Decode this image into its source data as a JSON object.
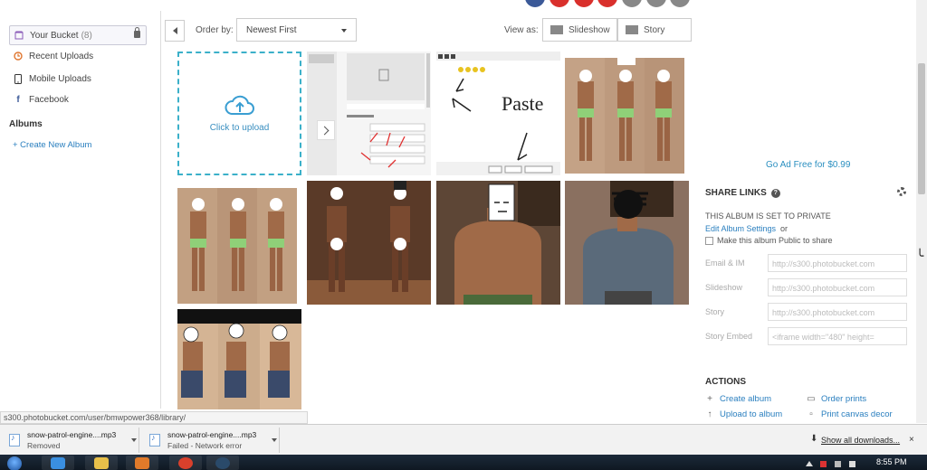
{
  "sidebar": {
    "items": [
      {
        "label": "Your Bucket",
        "count": "(8)",
        "icon": "bucket-icon"
      },
      {
        "label": "Recent Uploads",
        "icon": "clock-icon"
      },
      {
        "label": "Mobile Uploads",
        "icon": "mobile-icon"
      },
      {
        "label": "Facebook",
        "icon": "facebook-icon"
      }
    ],
    "albums_heading": "Albums",
    "create_album": "+ Create New Album"
  },
  "toolbar": {
    "order_by_label": "Order by:",
    "order_by_value": "Newest First",
    "view_as_label": "View as:",
    "slideshow_label": "Slideshow",
    "story_label": "Story"
  },
  "grid": {
    "upload_label": "Click to upload"
  },
  "panel": {
    "ad_free": "Go Ad Free for $0.99",
    "share_heading": "SHARE LINKS",
    "private_text": "THIS ALBUM IS SET TO PRIVATE",
    "edit_settings": "Edit Album Settings",
    "edit_or": "or",
    "make_public": "Make this album Public to share",
    "fields": [
      {
        "label": "Email & IM",
        "value": "http://s300.photobucket.com"
      },
      {
        "label": "Slideshow",
        "value": "http://s300.photobucket.com"
      },
      {
        "label": "Story",
        "value": "http://s300.photobucket.com"
      },
      {
        "label": "Story Embed",
        "value": "<iframe width=\"480\" height="
      }
    ],
    "actions_heading": "ACTIONS",
    "actions": {
      "create_album": "Create album",
      "order_prints": "Order prints",
      "upload_to_album": "Upload to album",
      "print_canvas": "Print canvas decor"
    }
  },
  "status_url": "s300.photobucket.com/user/bmwpower368/library/",
  "downloads": {
    "items": [
      {
        "name": "snow-patrol-engine....mp3",
        "status": "Removed"
      },
      {
        "name": "snow-patrol-engine....mp3",
        "status": "Failed - Network error"
      }
    ],
    "show_all": "Show all downloads...",
    "close": "×"
  },
  "taskbar": {
    "clock": "8:55 PM"
  },
  "colors": {
    "link": "#2a7fbf",
    "upload_border": "#3bb0c9"
  }
}
